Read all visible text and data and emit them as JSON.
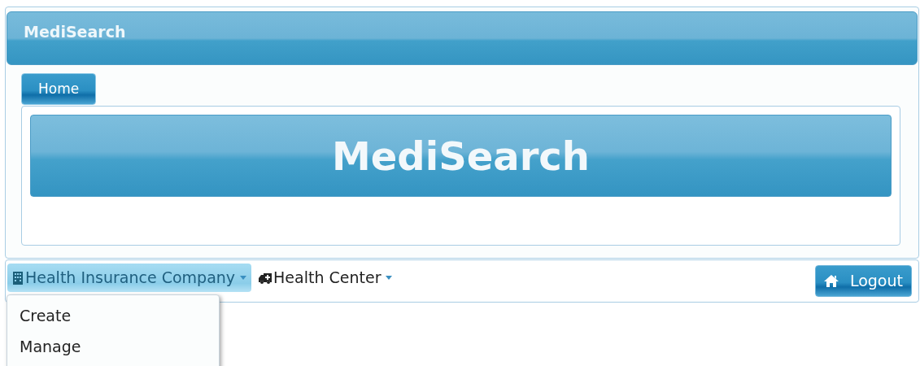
{
  "header": {
    "title": "MediSearch"
  },
  "tabs": [
    {
      "label": "Home",
      "selected": true
    }
  ],
  "banner": {
    "title": "MediSearch"
  },
  "navbar": {
    "menus": [
      {
        "label": "Health Insurance Company",
        "kind": "building",
        "expanded": true,
        "items": [
          "Create",
          "Manage"
        ]
      },
      {
        "label": "Health Center",
        "kind": "ambulance",
        "expanded": false
      }
    ],
    "logout": "Logout"
  }
}
